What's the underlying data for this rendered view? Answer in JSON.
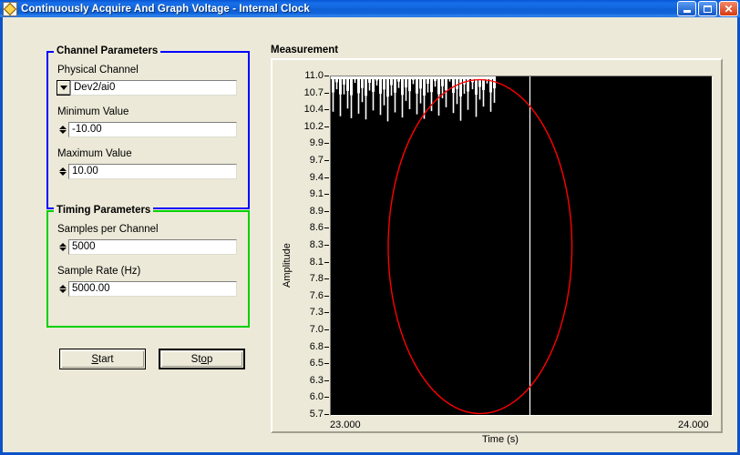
{
  "window": {
    "title": "Continuously Acquire And Graph Voltage - Internal Clock",
    "icon": "labview-diamond-icon",
    "minimize_label": "",
    "maximize_label": "",
    "close_label": "✕"
  },
  "channel_parameters": {
    "group_label": "Channel Parameters",
    "accent_color": "#0000ff",
    "physical_channel": {
      "label": "Physical Channel",
      "value": "Dev2/ai0",
      "control": "combo-box"
    },
    "minimum_value": {
      "label": "Minimum Value",
      "value": "-10.00",
      "control": "spinner"
    },
    "maximum_value": {
      "label": "Maximum Value",
      "value": "10.00",
      "control": "spinner"
    }
  },
  "timing_parameters": {
    "group_label": "Timing Parameters",
    "accent_color": "#00d000",
    "samples_per_channel": {
      "label": "Samples per Channel",
      "value": "5000",
      "control": "spinner"
    },
    "sample_rate": {
      "label": "Sample Rate (Hz)",
      "value": "5000.00",
      "control": "spinner"
    }
  },
  "actions": {
    "start": {
      "label": "Start",
      "accel": "S",
      "default": false
    },
    "stop": {
      "label": "Stop",
      "accel": "o",
      "default": true
    }
  },
  "measurement": {
    "title": "Measurement"
  },
  "chart_data": {
    "type": "line",
    "title": "Measurement",
    "xlabel": "Time (s)",
    "ylabel": "Amplitude",
    "xlim": [
      23.0,
      24.0
    ],
    "ylim": [
      5.7,
      11.0
    ],
    "xticks": [
      "23.000",
      "24.000"
    ],
    "yticks": [
      "11.0",
      "10.7",
      "10.4",
      "10.2",
      "9.9",
      "9.7",
      "9.4",
      "9.1",
      "8.9",
      "8.6",
      "8.3",
      "8.1",
      "7.8",
      "7.6",
      "7.3",
      "7.0",
      "6.8",
      "6.5",
      "6.3",
      "6.0",
      "5.7"
    ],
    "grid": false,
    "legend": "none",
    "plot_background": "#000000",
    "series": [
      {
        "name": "voltage-trace",
        "color": "#ffffff",
        "style": "clipped-comb",
        "description": "Dense white sampled waveform clipped at the 11.0 top rail, spikes descend to varying depths between 10.2 and 11.0 across the left portion of the span; a single full-height vertical white cursor line sits near t = 23.52 s.",
        "comb_depths": [
          10.45,
          10.8,
          10.38,
          10.72,
          10.5,
          10.35,
          10.9,
          10.42,
          10.6,
          10.33,
          10.78,
          10.47,
          10.86,
          10.4,
          10.55,
          10.3,
          10.7,
          10.44,
          10.82,
          10.36,
          10.62,
          10.49,
          10.88,
          10.41,
          10.58,
          10.34,
          10.75,
          10.46,
          10.84,
          10.39,
          10.66,
          10.52,
          10.92,
          10.43,
          10.57,
          10.31,
          10.73,
          10.48,
          10.8,
          10.37,
          10.64,
          10.53,
          10.89,
          10.45,
          10.59
        ],
        "cursor_x": 23.52
      },
      {
        "name": "fit-ellipse",
        "color": "#ff0000",
        "style": "ellipse",
        "description": "Red elliptical envelope centred at t = 23.39 s, amplitude 8.35, spanning roughly t = 23.15 to 23.63 s and amplitude 5.75 to 10.95.",
        "center_x": 23.39,
        "center_y": 8.35,
        "radius_x": 0.24,
        "radius_y": 2.6
      }
    ]
  }
}
